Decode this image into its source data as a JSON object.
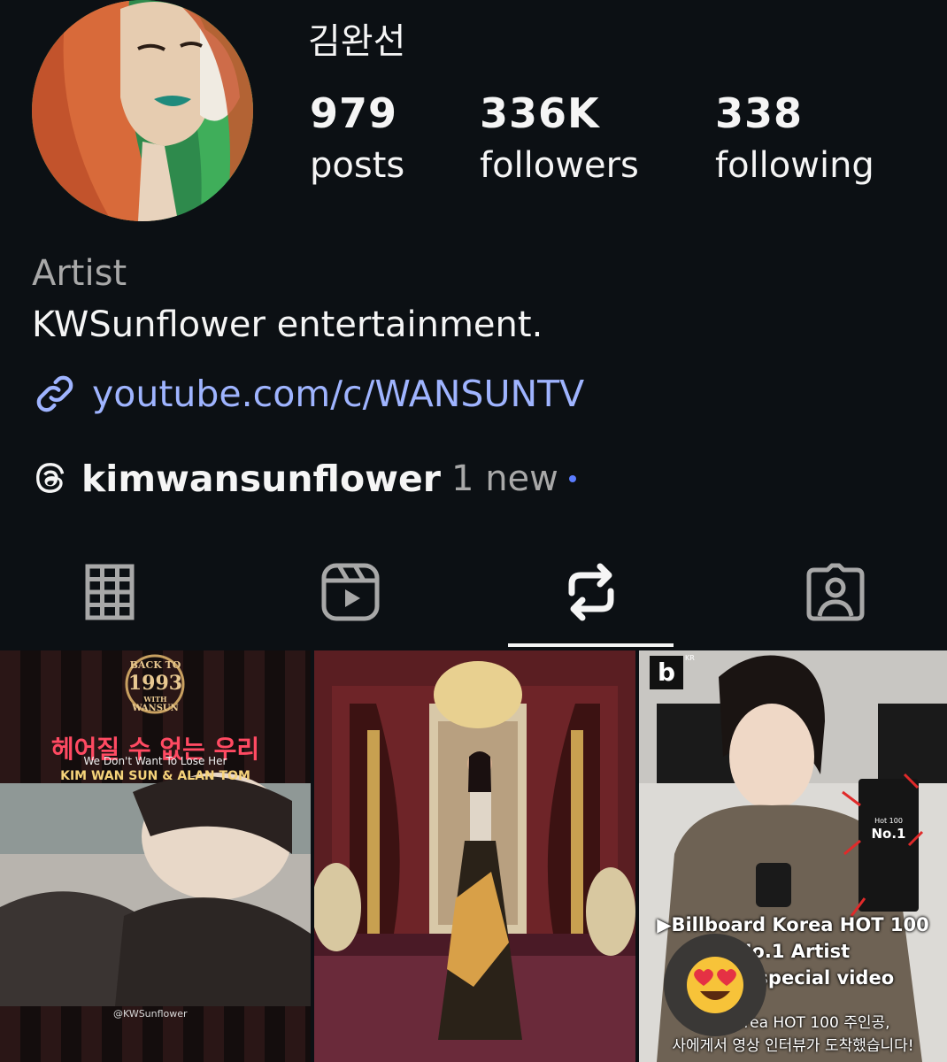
{
  "profile": {
    "username": "김완선",
    "stats": [
      {
        "value": "979",
        "label": "posts"
      },
      {
        "value": "336K",
        "label": "followers"
      },
      {
        "value": "338",
        "label": "following"
      }
    ],
    "category": "Artist",
    "bio": "KWSunflower entertainment.",
    "link": "youtube.com/c/WANSUNTV",
    "threads": {
      "handle": "kimwansunflower",
      "new_label": "1 new"
    }
  },
  "tabs": [
    {
      "icon": "grid-icon"
    },
    {
      "icon": "reels-icon"
    },
    {
      "icon": "reposts-icon",
      "active": true
    },
    {
      "icon": "tagged-icon"
    }
  ],
  "posts": {
    "p1": {
      "badge_top": "BACK TO",
      "badge_year": "1993",
      "badge_with": "WITH",
      "badge_name": "WANSUN",
      "title_kr": "헤어질 수 없는 우리",
      "subtitle": "We Don't Want To Lose Her",
      "credits": "KIM WAN SUN  & ALAN TOM",
      "watermark": "@KWSunflower"
    },
    "p3": {
      "logo": "b",
      "logo_kr": "KR",
      "trophy_title": "Hot 100",
      "trophy_rank": "No.1",
      "line1": "▶Billboard Korea HOT 100",
      "line2": "No.1 Artist",
      "line3": "t us a special video",
      "line4": "ard Korea HOT 100 주인공,",
      "line5": "사에게서 영상 인터뷰가 도착했습니다!"
    }
  },
  "reaction": {
    "emoji": "😍"
  },
  "colors": {
    "background": "#0c1014",
    "link": "#9fb4ff",
    "muted": "#a8a8a8",
    "dot": "#5b7cff"
  }
}
